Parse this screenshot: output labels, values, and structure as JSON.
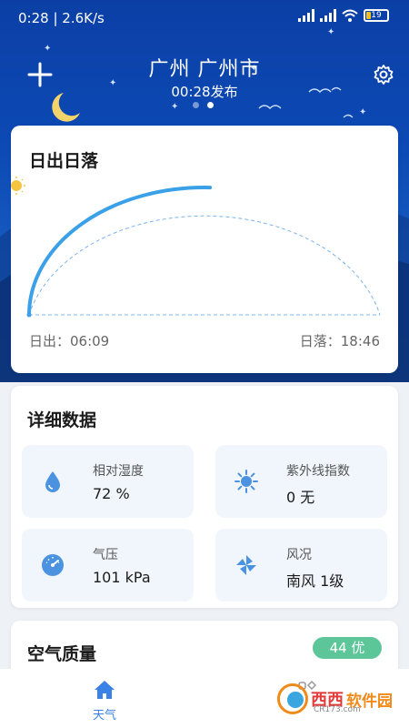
{
  "status_bar": {
    "time": "0:28",
    "speed": "2.6K/s",
    "battery": "19"
  },
  "header": {
    "city": "广州  广州市",
    "published": "00:28发布",
    "page_count": 2,
    "active_page": 1
  },
  "sun_card": {
    "title": "日出日落",
    "sunrise": "日出：06:09",
    "sunset": "日落：18:46",
    "progress": 0.51
  },
  "detail_card": {
    "title": "详细数据",
    "tiles": [
      {
        "label": "相对湿度",
        "value": "72 %",
        "icon": "droplet-icon"
      },
      {
        "label": "紫外线指数",
        "value": "0  无",
        "icon": "sun-icon"
      },
      {
        "label": "气压",
        "value": "101 kPa",
        "icon": "gauge-icon"
      },
      {
        "label": "风况",
        "value": "南风 1级",
        "icon": "pinwheel-icon"
      }
    ]
  },
  "air_card": {
    "title": "空气质量",
    "badge": "44 优"
  },
  "nav": {
    "home_label": "天气"
  },
  "watermark": {
    "name": "西西",
    "name2": "软件园",
    "site": "CR173.com"
  },
  "colors": {
    "sky": "#0d4ab5",
    "accent": "#3b82e6",
    "aq_good": "#5dc699"
  }
}
